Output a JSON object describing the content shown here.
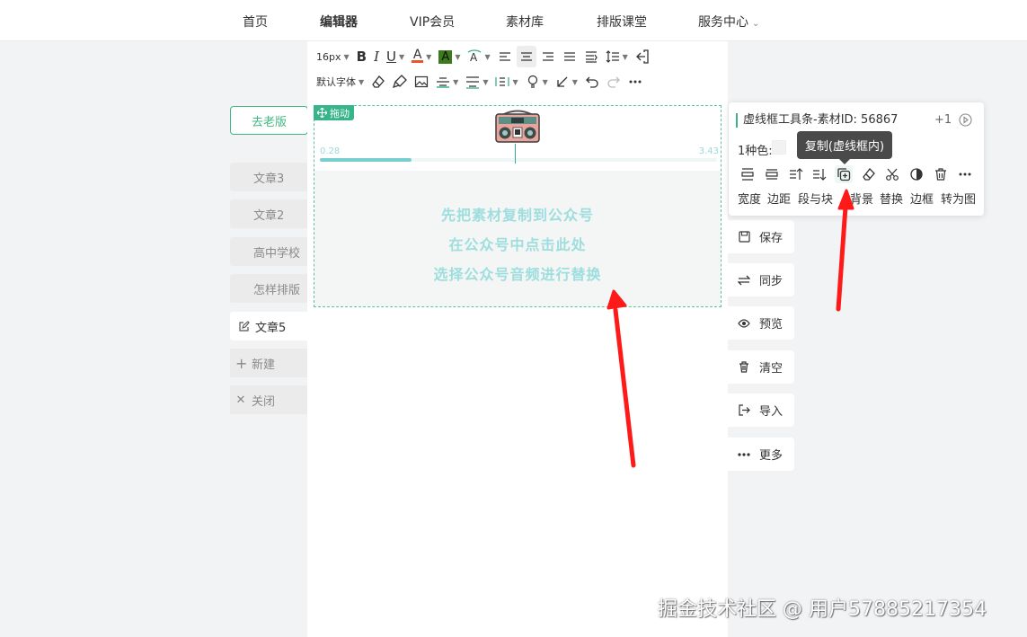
{
  "topnav": {
    "items": [
      {
        "label": "首页",
        "active": false
      },
      {
        "label": "编辑器",
        "active": true
      },
      {
        "label": "VIP会员",
        "active": false
      },
      {
        "label": "素材库",
        "active": false
      },
      {
        "label": "排版课堂",
        "active": false
      },
      {
        "label": "服务中心",
        "active": false,
        "dropdown": true
      }
    ]
  },
  "left": {
    "old_version": "去老版",
    "articles": [
      {
        "label": "文章3",
        "active": false
      },
      {
        "label": "文章2",
        "active": false
      },
      {
        "label": "高中学校",
        "active": false
      },
      {
        "label": "怎样排版",
        "active": false
      },
      {
        "label": "文章5",
        "active": true
      }
    ],
    "new_label": "新建",
    "close_label": "关闭"
  },
  "toolbar": {
    "font_size": "16px",
    "font_family": "默认字体",
    "text_color": "#e8572a",
    "bg_color": "#3d7a1e"
  },
  "material": {
    "drag_label": "拖动",
    "time_left": "0.28",
    "time_right": "3.43",
    "progress": 0.23,
    "lines": [
      "先把素材复制到公众号",
      "在公众号中点击此处",
      "选择公众号音频进行替换"
    ]
  },
  "actions": [
    {
      "label": "保存",
      "icon": "save-icon"
    },
    {
      "label": "同步",
      "icon": "sync-icon"
    },
    {
      "label": "预览",
      "icon": "eye-icon"
    },
    {
      "label": "清空",
      "icon": "trash-icon"
    },
    {
      "label": "导入",
      "icon": "import-icon"
    },
    {
      "label": "更多",
      "icon": "more-icon"
    }
  ],
  "panel": {
    "title": "虚线框工具条-素材ID: 56867",
    "plus": "+1",
    "color_label": "1种色:",
    "tooltip": "复制(虚线框内)",
    "labels": [
      "宽度",
      "边距",
      "段与块",
      "背景",
      "替换",
      "边框",
      "转为图"
    ]
  },
  "watermark": "掘金技术社区 @ 用户57885217354",
  "accent_color": "#38b48b",
  "arrow_color": "#ff1a1a"
}
